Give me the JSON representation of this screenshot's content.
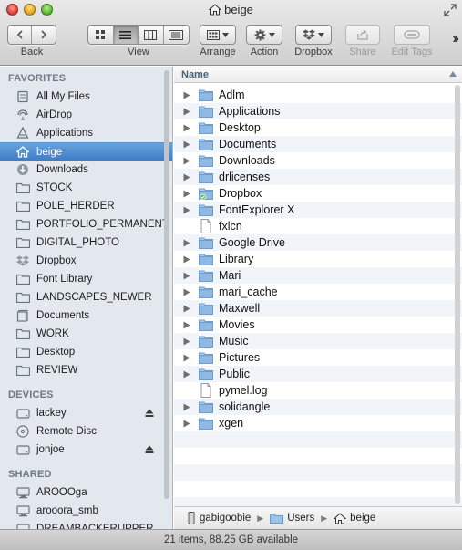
{
  "window": {
    "title": "beige"
  },
  "toolbar": {
    "back_label": "Back",
    "view_label": "View",
    "arrange_label": "Arrange",
    "action_label": "Action",
    "dropbox_label": "Dropbox",
    "share_label": "Share",
    "edit_tags_label": "Edit Tags",
    "active_view": "list"
  },
  "sidebar": {
    "favorites_header": "FAVORITES",
    "favorites": [
      {
        "label": "All My Files",
        "icon": "all-files-icon"
      },
      {
        "label": "AirDrop",
        "icon": "airdrop-icon"
      },
      {
        "label": "Applications",
        "icon": "applications-icon"
      },
      {
        "label": "beige",
        "icon": "home-icon",
        "selected": true
      },
      {
        "label": "Downloads",
        "icon": "downloads-icon"
      },
      {
        "label": "STOCK",
        "icon": "folder-icon"
      },
      {
        "label": "POLE_HERDER",
        "icon": "folder-icon"
      },
      {
        "label": "PORTFOLIO_PERMANENT",
        "icon": "folder-icon"
      },
      {
        "label": "DIGITAL_PHOTO",
        "icon": "folder-icon"
      },
      {
        "label": "Dropbox",
        "icon": "dropbox-icon"
      },
      {
        "label": "Font Library",
        "icon": "folder-icon"
      },
      {
        "label": "LANDSCAPES_NEWER",
        "icon": "folder-icon"
      },
      {
        "label": "Documents",
        "icon": "documents-icon"
      },
      {
        "label": "WORK",
        "icon": "folder-icon"
      },
      {
        "label": "Desktop",
        "icon": "folder-icon"
      },
      {
        "label": "REVIEW",
        "icon": "folder-icon"
      }
    ],
    "devices_header": "DEVICES",
    "devices": [
      {
        "label": "lackey",
        "icon": "disk-icon",
        "eject": true
      },
      {
        "label": "Remote Disc",
        "icon": "remote-disc-icon",
        "eject": false
      },
      {
        "label": "jonjoe",
        "icon": "disk-icon",
        "eject": true
      }
    ],
    "shared_header": "SHARED",
    "shared": [
      {
        "label": "AROOOga",
        "icon": "server-icon"
      },
      {
        "label": "arooога_smb",
        "icon": "server-icon"
      },
      {
        "label": "DREAMBACKERUPPER",
        "icon": "server-icon"
      }
    ]
  },
  "list": {
    "column_name": "Name",
    "items": [
      {
        "label": "Adlm",
        "kind": "folder",
        "expandable": true
      },
      {
        "label": "Applications",
        "kind": "folder",
        "expandable": true
      },
      {
        "label": "Desktop",
        "kind": "folder",
        "expandable": true
      },
      {
        "label": "Documents",
        "kind": "folder",
        "expandable": true
      },
      {
        "label": "Downloads",
        "kind": "folder",
        "expandable": true
      },
      {
        "label": "drlicenses",
        "kind": "folder",
        "expandable": true
      },
      {
        "label": "Dropbox",
        "kind": "dropbox",
        "expandable": true
      },
      {
        "label": "FontExplorer X",
        "kind": "folder",
        "expandable": true
      },
      {
        "label": "fxlcn",
        "kind": "file",
        "expandable": false
      },
      {
        "label": "Google Drive",
        "kind": "folder",
        "expandable": true
      },
      {
        "label": "Library",
        "kind": "folder",
        "expandable": true
      },
      {
        "label": "Mari",
        "kind": "folder",
        "expandable": true
      },
      {
        "label": "mari_cache",
        "kind": "folder",
        "expandable": true
      },
      {
        "label": "Maxwell",
        "kind": "folder",
        "expandable": true
      },
      {
        "label": "Movies",
        "kind": "folder",
        "expandable": true
      },
      {
        "label": "Music",
        "kind": "folder",
        "expandable": true
      },
      {
        "label": "Pictures",
        "kind": "folder",
        "expandable": true
      },
      {
        "label": "Public",
        "kind": "folder",
        "expandable": true
      },
      {
        "label": "pymel.log",
        "kind": "file",
        "expandable": false
      },
      {
        "label": "solidangle",
        "kind": "folder",
        "expandable": true
      },
      {
        "label": "xgen",
        "kind": "folder",
        "expandable": true
      }
    ]
  },
  "pathbar": {
    "segments": [
      "gabigoobie",
      "Users",
      "beige"
    ]
  },
  "status": {
    "text": "21 items, 88.25 GB available"
  },
  "colors": {
    "selection": "#3f7cc5",
    "sidebar_bg": "#e3e8ee",
    "folder": "#8fb9e3"
  }
}
